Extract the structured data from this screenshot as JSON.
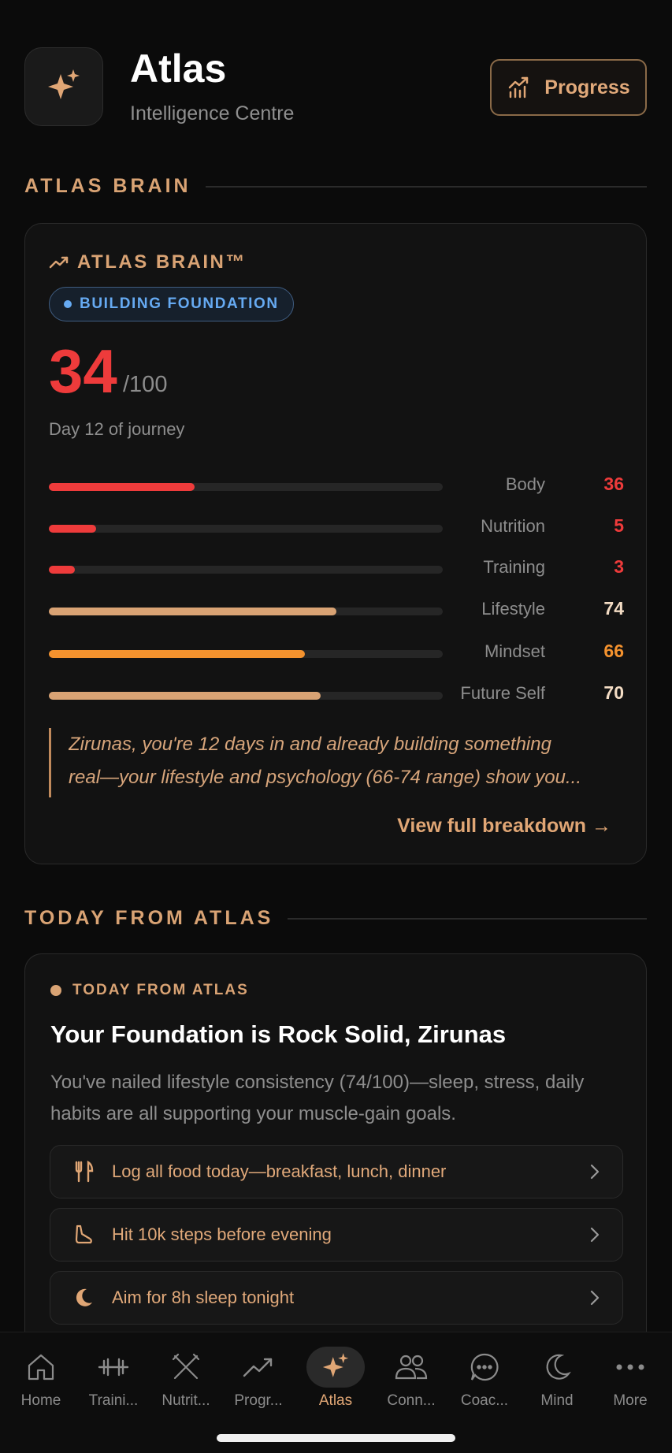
{
  "header": {
    "title": "Atlas",
    "subtitle": "Intelligence Centre",
    "progress_label": "Progress"
  },
  "section_brain": {
    "label": "ATLAS BRAIN"
  },
  "brain": {
    "title": "ATLAS BRAIN™",
    "status": "BUILDING FOUNDATION",
    "score": "34",
    "score_max": "/100",
    "journey": "Day 12 of journey",
    "metrics": [
      {
        "label": "Body",
        "value": "36",
        "fraction": 0.37,
        "color": "#ee3b3b"
      },
      {
        "label": "Nutrition",
        "value": "5",
        "fraction": 0.12,
        "color": "#ee3b3b"
      },
      {
        "label": "Training",
        "value": "3",
        "fraction": 0.065,
        "color": "#ee3b3b"
      },
      {
        "label": "Lifestyle",
        "value": "74",
        "fraction": 0.73,
        "color": "#d9a374"
      },
      {
        "label": "Mindset",
        "value": "66",
        "fraction": 0.65,
        "color": "#f4922e"
      },
      {
        "label": "Future Self",
        "value": "70",
        "fraction": 0.69,
        "color": "#d9a374"
      }
    ],
    "value_colors": {
      "low": "#ee3b3b",
      "mid": "#f4922e",
      "high": "#f3dcc4"
    },
    "quote_line1": "Zirunas, you're 12 days in and already building something",
    "quote_line2": "real—your lifestyle and psychology (66-74 range) show you...",
    "breakdown_label": "View full breakdown →"
  },
  "section_today": {
    "label": "TODAY FROM ATLAS"
  },
  "today": {
    "tag": "TODAY FROM ATLAS",
    "headline": "Your Foundation is Rock Solid, Zirunas",
    "body": "You've nailed lifestyle consistency (74/100)—sleep, stress, daily habits are all supporting your muscle-gain goals.",
    "actions": [
      {
        "icon": "fork-knife-icon",
        "label": "Log all food today—breakfast, lunch, dinner"
      },
      {
        "icon": "footprint-icon",
        "label": "Hit 10k steps before evening"
      },
      {
        "icon": "moon-icon",
        "label": "Aim for 8h sleep tonight"
      }
    ]
  },
  "nav": {
    "items": [
      {
        "icon": "home-icon",
        "label": "Home"
      },
      {
        "icon": "dumbbell-icon",
        "label": "Traini..."
      },
      {
        "icon": "fork-knife-icon",
        "label": "Nutrit..."
      },
      {
        "icon": "trend-icon",
        "label": "Progr..."
      },
      {
        "icon": "sparkle-icon",
        "label": "Atlas"
      },
      {
        "icon": "people-icon",
        "label": "Conn..."
      },
      {
        "icon": "chat-icon",
        "label": "Coac..."
      },
      {
        "icon": "moon-icon",
        "label": "Mind"
      },
      {
        "icon": "more-icon",
        "label": "More"
      }
    ],
    "active": "Atlas"
  },
  "colors": {
    "accent": "#d9a374",
    "score_red": "#ee3b3b",
    "status_blue": "#66aaf2",
    "background": "#0b0b0b"
  }
}
